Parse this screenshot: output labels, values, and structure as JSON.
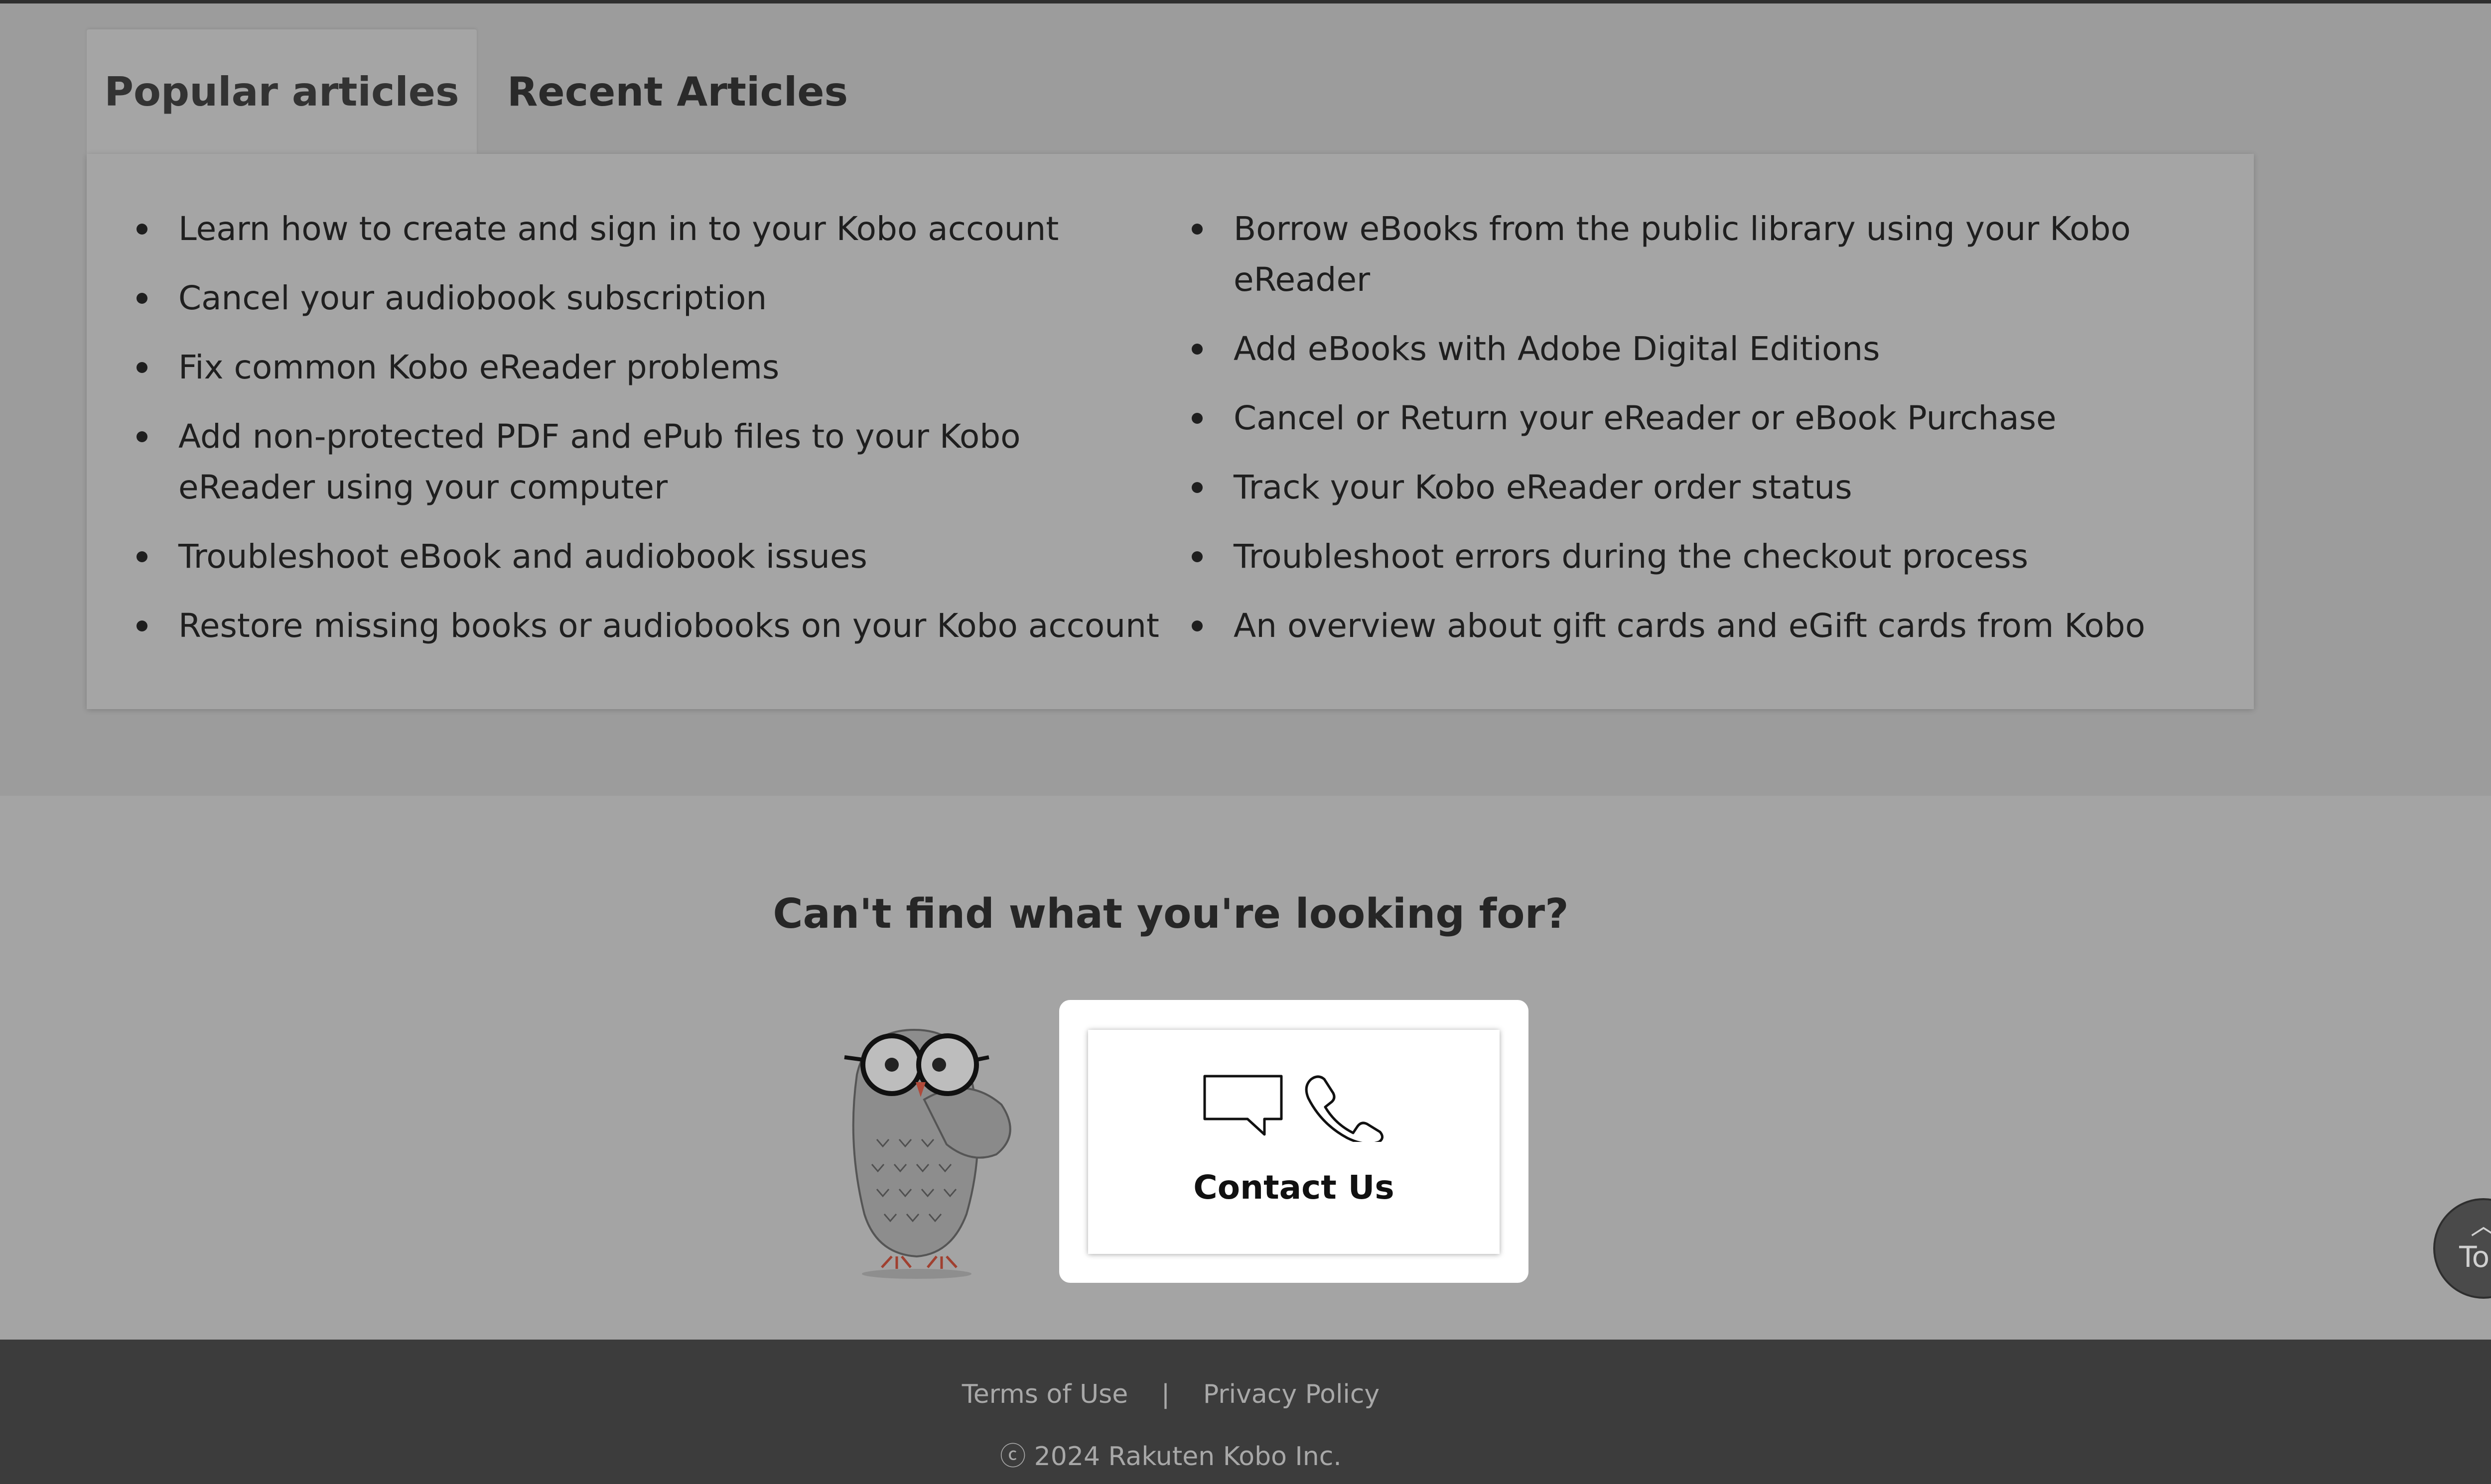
{
  "tabs": {
    "popular_label": "Popular articles",
    "recent_label": "Recent Articles"
  },
  "popular_articles": {
    "left": [
      "Learn how to create and sign in to your Kobo account",
      "Cancel your audiobook subscription",
      "Fix common Kobo eReader problems",
      "Add non-protected PDF and ePub files to your Kobo eReader using your computer",
      "Troubleshoot eBook and audiobook issues",
      "Restore missing books or audiobooks on your Kobo account"
    ],
    "right": [
      "Borrow eBooks from the public library using your Kobo eReader",
      "Add eBooks with Adobe Digital Editions",
      "Cancel or Return your eReader or eBook Purchase",
      "Track your Kobo eReader order status",
      "Troubleshoot errors during the checkout process",
      "An overview about gift cards and eGift cards from Kobo"
    ]
  },
  "help": {
    "title": "Can't find what you're looking for?",
    "contact_label": "Contact Us",
    "icons": [
      "chat-bubble-icon",
      "phone-icon",
      "owl-mascot-icon"
    ]
  },
  "back_to_top": {
    "label": "Top",
    "icon": "chevron-up-icon"
  },
  "footer": {
    "terms": "Terms of Use",
    "separator": "|",
    "privacy": "Privacy Policy",
    "copyright": "ⓒ 2024 Rakuten Kobo Inc."
  }
}
